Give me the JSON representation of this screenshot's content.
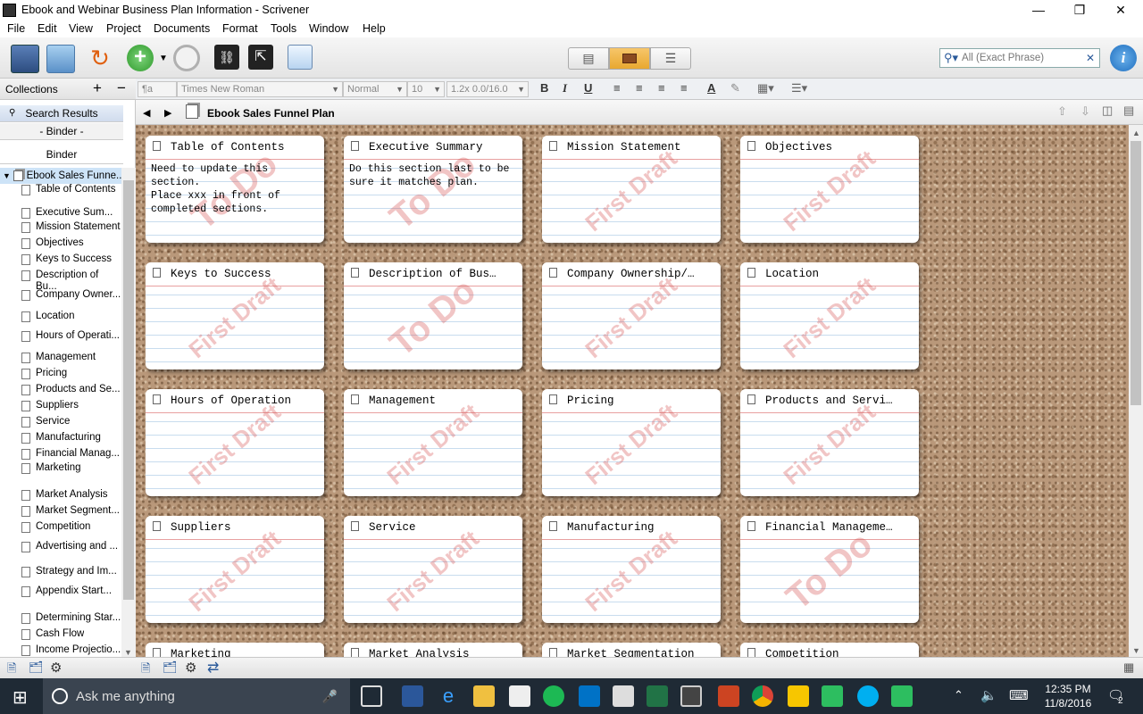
{
  "window": {
    "title": "Ebook and Webinar Business Plan Information - Scrivener"
  },
  "menu": [
    "File",
    "Edit",
    "View",
    "Project",
    "Documents",
    "Format",
    "Tools",
    "Window",
    "Help"
  ],
  "search": {
    "scope": "All (Exact Phrase)"
  },
  "format": {
    "style": "¶a",
    "font": "Times New Roman",
    "preset": "Normal",
    "size": "10",
    "spacing": "1.2x 0.0/16.0",
    "bold": "B",
    "italic": "I",
    "underline": "U"
  },
  "sidebar": {
    "collections_label": "Collections",
    "tabs": [
      "Search Results",
      "- Binder -",
      "Binder"
    ],
    "root": "Ebook Sales Funne...",
    "items": [
      "Table of Contents",
      "Executive Sum...",
      "Mission Statement",
      "Objectives",
      "Keys to Success",
      "Description of Bu...",
      "Company Owner...",
      "Location",
      "Hours of Operati...",
      "Management",
      "Pricing",
      "Products and Se...",
      "Suppliers",
      "Service",
      "Manufacturing",
      "Financial Manag...",
      "Marketing",
      "Market Analysis",
      "Market Segment...",
      "Competition",
      "Advertising and ...",
      "Strategy and Im...",
      "Appendix Start...",
      "Determining Star...",
      "Cash Flow",
      "Income Projectio..."
    ]
  },
  "editor": {
    "doc_title": "Ebook Sales Funnel Plan"
  },
  "cards": [
    {
      "title": "Table of Contents",
      "synopsis": "Need to update this section.\nPlace xxx in front of completed sections.",
      "stamp": "To Do"
    },
    {
      "title": "Executive Summary",
      "synopsis": "Do this section last to be sure it matches plan.",
      "stamp": "To Do"
    },
    {
      "title": "Mission Statement",
      "synopsis": "",
      "stamp": "First Draft"
    },
    {
      "title": "Objectives",
      "synopsis": "",
      "stamp": "First Draft"
    },
    {
      "title": "Keys to Success",
      "synopsis": "",
      "stamp": "First Draft"
    },
    {
      "title": "Description of Bus…",
      "synopsis": "",
      "stamp": "To Do"
    },
    {
      "title": "Company Ownership/…",
      "synopsis": "",
      "stamp": "First Draft"
    },
    {
      "title": "Location",
      "synopsis": "",
      "stamp": "First Draft"
    },
    {
      "title": "Hours of Operation",
      "synopsis": "",
      "stamp": "First Draft"
    },
    {
      "title": "Management",
      "synopsis": "",
      "stamp": "First Draft"
    },
    {
      "title": "Pricing",
      "synopsis": "",
      "stamp": "First Draft"
    },
    {
      "title": "Products and Servi…",
      "synopsis": "",
      "stamp": "First Draft"
    },
    {
      "title": "Suppliers",
      "synopsis": "",
      "stamp": "First Draft"
    },
    {
      "title": "Service",
      "synopsis": "",
      "stamp": "First Draft"
    },
    {
      "title": "Manufacturing",
      "synopsis": "",
      "stamp": "First Draft"
    },
    {
      "title": "Financial Manageme…",
      "synopsis": "",
      "stamp": "To Do"
    },
    {
      "title": "Marketing",
      "synopsis": "",
      "stamp": ""
    },
    {
      "title": "Market Analysis",
      "synopsis": "",
      "stamp": ""
    },
    {
      "title": "Market Segmentation",
      "synopsis": "",
      "stamp": ""
    },
    {
      "title": "Competition",
      "synopsis": "",
      "stamp": ""
    }
  ],
  "taskbar": {
    "search_placeholder": "Ask me anything",
    "time": "12:35 PM",
    "date": "11/8/2016",
    "notifications": "2"
  }
}
